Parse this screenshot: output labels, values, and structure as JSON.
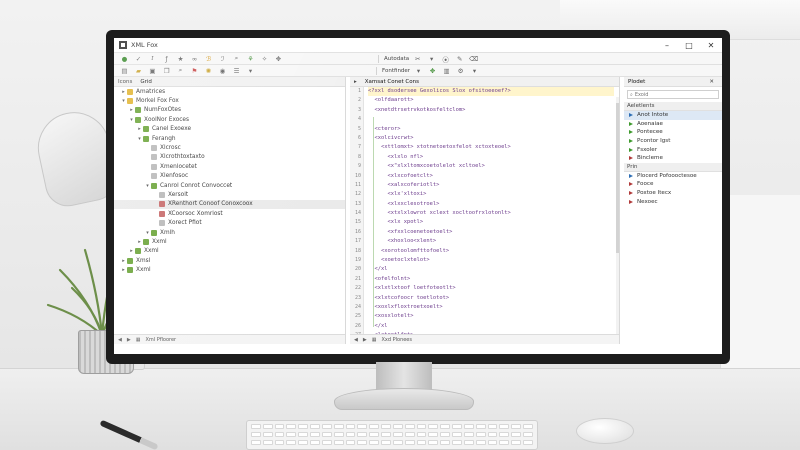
{
  "window": {
    "title": "XML Fox"
  },
  "toolbar1": {
    "tabs": [
      "Autodata"
    ]
  },
  "toolbar2": {
    "text": "Fontfinder"
  },
  "left_pane": {
    "tabs": [
      "Icons",
      "Grid"
    ],
    "tree": [
      {
        "indent": 0,
        "twisty": "▸",
        "icon": "folder",
        "label": "Amatrices"
      },
      {
        "indent": 0,
        "twisty": "▾",
        "icon": "folder",
        "label": "Morkel Fox Fox"
      },
      {
        "indent": 1,
        "twisty": "▸",
        "icon": "node",
        "label": "NumFoxOtes"
      },
      {
        "indent": 1,
        "twisty": "▾",
        "icon": "node",
        "label": "XoolNor Exoces"
      },
      {
        "indent": 2,
        "twisty": "▸",
        "icon": "node",
        "label": "Canel Exoexe"
      },
      {
        "indent": 2,
        "twisty": "▾",
        "icon": "node",
        "label": "Ferangh"
      },
      {
        "indent": 3,
        "twisty": "",
        "icon": "leaf",
        "label": "Xlcrosc"
      },
      {
        "indent": 3,
        "twisty": "",
        "icon": "leaf",
        "label": "Xlcrothtoxtaxto"
      },
      {
        "indent": 3,
        "twisty": "",
        "icon": "leaf",
        "label": "Xmenlocetet"
      },
      {
        "indent": 3,
        "twisty": "",
        "icon": "leaf",
        "label": "Xlenfosoc"
      },
      {
        "indent": 3,
        "twisty": "▾",
        "icon": "node",
        "label": "Canrol Conrot Convoccet"
      },
      {
        "indent": 4,
        "twisty": "",
        "icon": "leaf",
        "label": "Xersolt"
      },
      {
        "indent": 4,
        "twisty": "",
        "icon": "attr",
        "label": "XRenthort Conoof Conoxcoox"
      },
      {
        "indent": 4,
        "twisty": "",
        "icon": "attr",
        "label": "XCoorsoc Xomriost"
      },
      {
        "indent": 4,
        "twisty": "",
        "icon": "leaf",
        "label": "Xorect Pfiot"
      },
      {
        "indent": 3,
        "twisty": "▾",
        "icon": "node",
        "label": "Xmlh"
      },
      {
        "indent": 2,
        "twisty": "▸",
        "icon": "node",
        "label": "Xxml"
      },
      {
        "indent": 1,
        "twisty": "▸",
        "icon": "node",
        "label": "Xxml"
      },
      {
        "indent": 0,
        "twisty": "▸",
        "icon": "node",
        "label": "Xmsl"
      },
      {
        "indent": 0,
        "twisty": "▸",
        "icon": "node",
        "label": "Xxml"
      }
    ],
    "status": "Xml Pfloorer"
  },
  "editor": {
    "tab": "Xamsat Conet Cons",
    "highlight_line": 1,
    "lines": [
      "<?xxl dsodersee Gexolicos Slox ofsitoeeoef?>",
      "  <olfdaarott>",
      "  <xnetdtrsetrvkotkosfeltclom>",
      "",
      "  <cteror>",
      "  <xolcivcrwt>",
      "    <xttlomxt> xtotnetoetoxfelot xctoxteoel>",
      "      <xlxlo nfl>",
      "      <x\"xlxltomxcoetolelot xcltoel>",
      "      <xlxcofoetclt>",
      "      <xalxcoferiotlt>",
      "      <xlx'xltoxi>",
      "      <xlxxclesotroel>",
      "      <xtxlxlowrot xclext xocltoofrxlotonlt>",
      "      <xlx xpotl>",
      "      <xfxxlcoenetoetoelt>",
      "      <xhoxloo<xlent>",
      "    <xorotoolomfttofoelt>",
      "    <xoetoclxtelot>",
      "  </xl",
      "  <ofelfolnt>",
      "  <xlxtlxtoof loetfoteotlt>",
      "  <xlxtcofoocr toetlotot>",
      "  <xoxlxfloxtroetxoelt>",
      "  <xosxlotelt>",
      "  </xl",
      "  <lateetlfnt>",
      "  </xl",
      "  </el"
    ],
    "line_numbers": [
      "1",
      "2",
      "3",
      "4",
      "5",
      "6",
      "7",
      "8",
      "9",
      "10",
      "11",
      "12",
      "13",
      "14",
      "15",
      "16",
      "17",
      "18",
      "19",
      "20",
      "21",
      "22",
      "23",
      "24",
      "25",
      "26",
      "27",
      "28",
      "29"
    ],
    "status": "Xxd Plonees"
  },
  "right_pane": {
    "title": "Plodet",
    "search_placeholder": "Exoid",
    "section1": "Aeletlents",
    "section1_header": "Anot Intote",
    "items1": [
      {
        "arrow": "green",
        "label": "Aoenaiae"
      },
      {
        "arrow": "green",
        "label": "Pontecee"
      },
      {
        "arrow": "green",
        "label": "Pcontor Igst"
      },
      {
        "arrow": "green",
        "label": "Fsxoler"
      },
      {
        "arrow": "red",
        "label": "Bincleme"
      }
    ],
    "section2": "Prin",
    "items2": [
      {
        "arrow": "blue",
        "label": "Plocerd Pofoooctesoe"
      },
      {
        "arrow": "red",
        "label": "Fooce"
      },
      {
        "arrow": "red",
        "label": "Poxtoe Itecx"
      },
      {
        "arrow": "red",
        "label": "Nexoec"
      }
    ]
  }
}
